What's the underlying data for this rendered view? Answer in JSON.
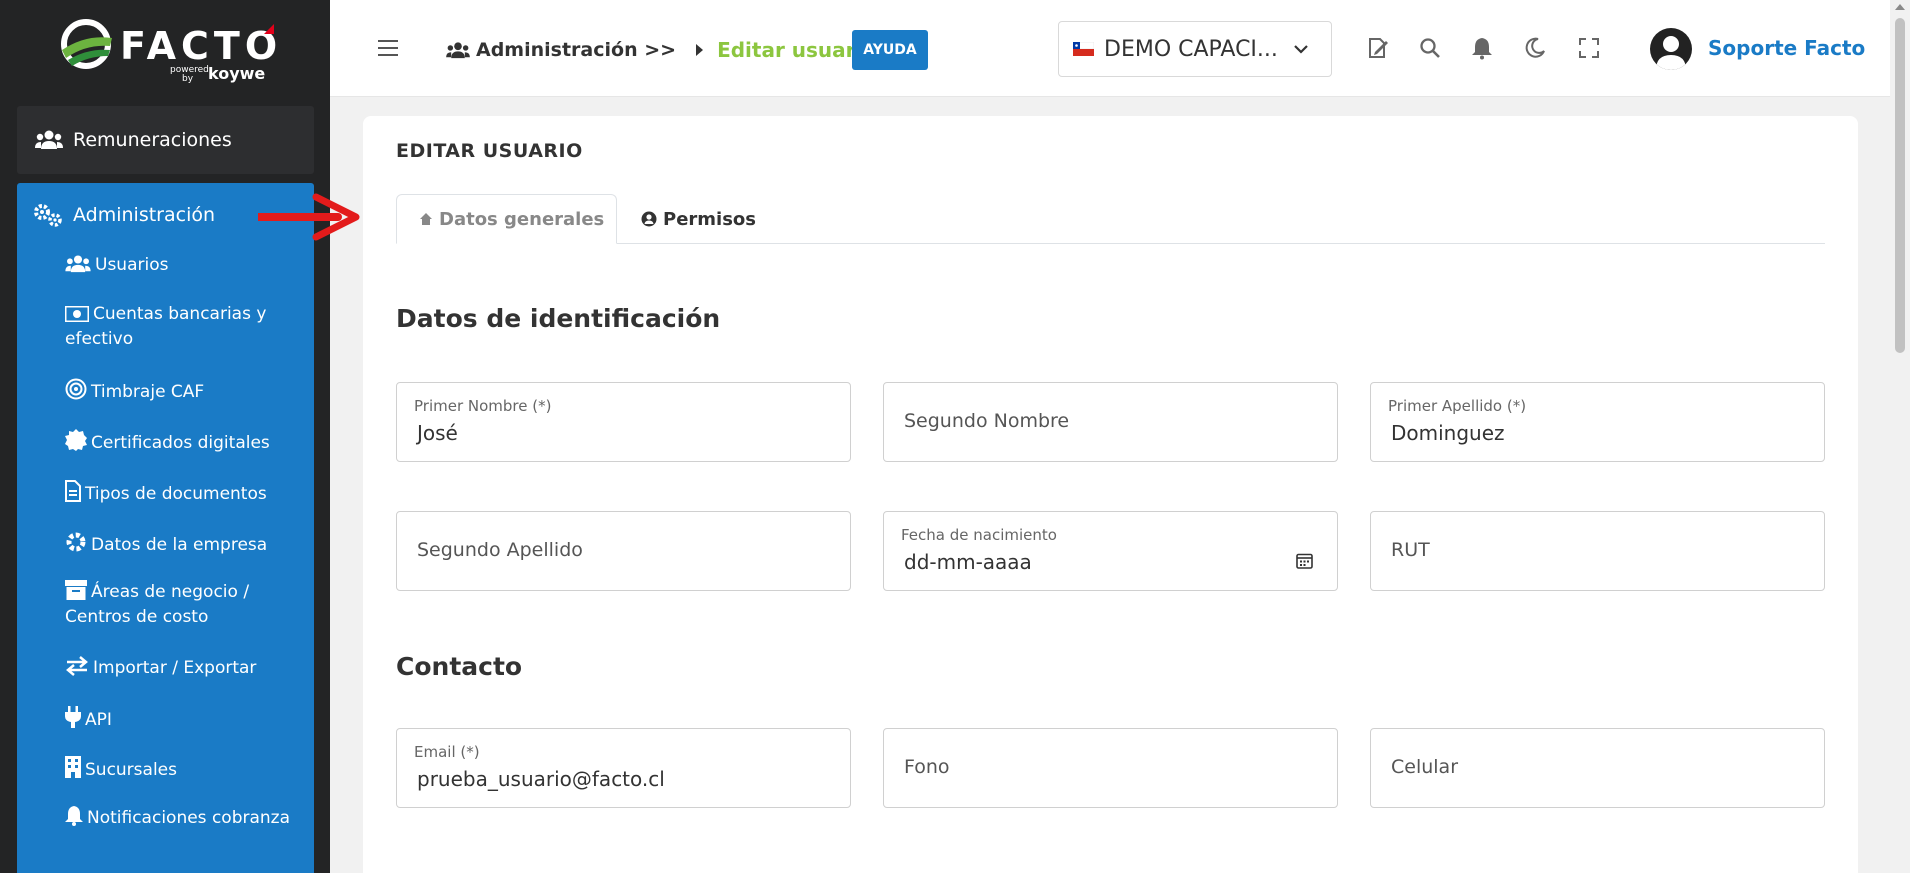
{
  "brand": {
    "name": "FACTO",
    "powered": "powered",
    "by": "by",
    "partner": "koywe",
    "accent": "#8cc63f",
    "primary": "#1a7bc6"
  },
  "sidebar": {
    "top_item": {
      "label": "Remuneraciones",
      "icon": "users-icon"
    },
    "section": {
      "label": "Administración",
      "icon": "gears-icon"
    },
    "items": [
      {
        "label": "Usuarios",
        "icon": "users-icon"
      },
      {
        "label": "Cuentas bancarias y efectivo",
        "icon": "money-icon"
      },
      {
        "label": "Timbraje CAF",
        "icon": "target-icon"
      },
      {
        "label": "Certificados digitales",
        "icon": "certificate-icon"
      },
      {
        "label": "Tipos de documentos",
        "icon": "file-icon"
      },
      {
        "label": "Datos de la empresa",
        "icon": "gear-icon"
      },
      {
        "label": "Áreas de negocio / Centros de costo",
        "icon": "archive-icon"
      },
      {
        "label": "Importar / Exportar",
        "icon": "exchange-icon"
      },
      {
        "label": "API",
        "icon": "plug-icon"
      },
      {
        "label": "Sucursales",
        "icon": "building-icon"
      },
      {
        "label": "Notificaciones cobranza",
        "icon": "bell-icon"
      }
    ]
  },
  "header": {
    "breadcrumb": {
      "parent": "Administración >>",
      "current": "Editar usuario"
    },
    "help_label": "AYUDA",
    "company_selector": {
      "value": "DEMO CAPACI..."
    },
    "user_name": "Soporte Facto"
  },
  "main": {
    "title": "EDITAR USUARIO",
    "tabs": [
      {
        "label": "Datos generales",
        "active": true
      },
      {
        "label": "Permisos",
        "active": false
      }
    ],
    "sections": {
      "identification": "Datos de identificación",
      "contact": "Contacto"
    },
    "fields": {
      "first_name": {
        "label": "Primer Nombre (*)",
        "value": "José"
      },
      "middle_name": {
        "placeholder": "Segundo Nombre"
      },
      "first_surname": {
        "label": "Primer Apellido (*)",
        "value": "Dominguez"
      },
      "second_surname": {
        "placeholder": "Segundo Apellido"
      },
      "birth_date": {
        "label": "Fecha de nacimiento",
        "value": "dd-mm-aaaa"
      },
      "rut": {
        "placeholder": "RUT"
      },
      "email": {
        "label": "Email (*)",
        "value": "prueba_usuario@facto.cl"
      },
      "phone": {
        "placeholder": "Fono"
      },
      "mobile": {
        "placeholder": "Celular"
      }
    }
  }
}
